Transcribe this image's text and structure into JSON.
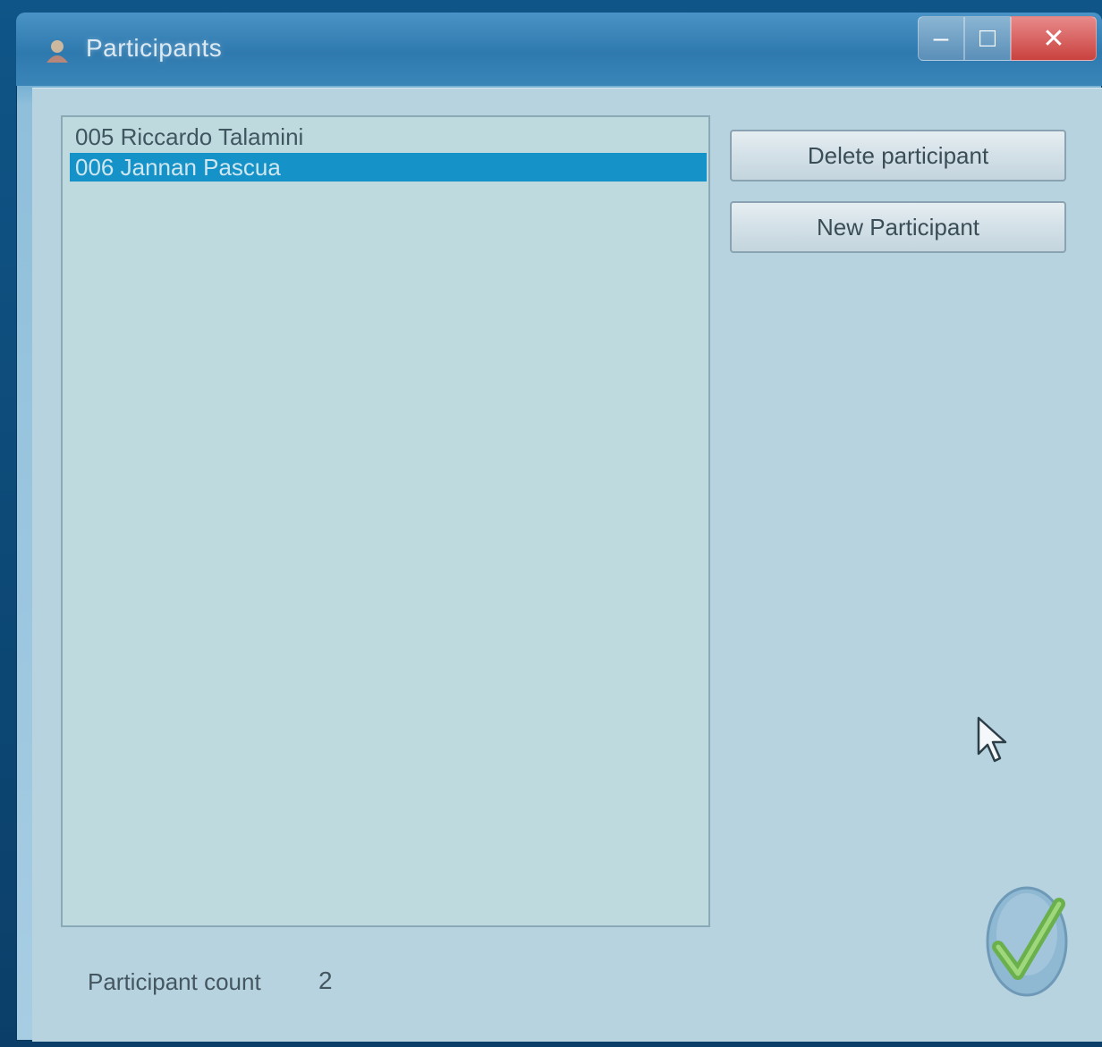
{
  "window": {
    "title": "Participants",
    "caption": {
      "minimize": "–",
      "maximize": "□",
      "close": "✕"
    }
  },
  "participants_list": {
    "items": [
      {
        "label": "005 Riccardo Talamini",
        "selected": false
      },
      {
        "label": "006 Jannan Pascua",
        "selected": true
      }
    ]
  },
  "buttons": {
    "delete_label": "Delete participant",
    "new_label": "New Participant"
  },
  "footer": {
    "count_label": "Participant count",
    "count_value": "2"
  },
  "colors": {
    "selection": "#1592c8",
    "client_background": "#b7d3df",
    "ok_icon": "#6ab04c"
  },
  "icons": {
    "app": "app-icon",
    "ok": "checkmark-icon",
    "pointer": "mouse-cursor-icon"
  }
}
